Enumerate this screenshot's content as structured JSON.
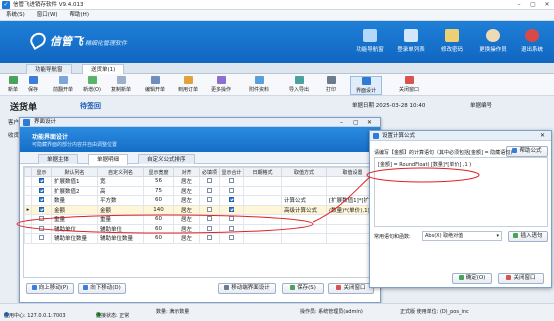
{
  "app": {
    "title": "信管飞进销存软件 V9.4.013"
  },
  "menu": [
    "系统(S)",
    "窗口(W)",
    "帮助(H)"
  ],
  "brand": {
    "name": "信管飞",
    "tagline": "精细化管理软件",
    "color": "#1066c0"
  },
  "banner_buttons": [
    {
      "label": "功能导航窗",
      "icon": "navigation-icon"
    },
    {
      "label": "登录单列表",
      "icon": "list-icon"
    },
    {
      "label": "修改密码",
      "icon": "key-icon"
    },
    {
      "label": "更换操作员",
      "icon": "user-switch-icon"
    },
    {
      "label": "退出系统",
      "icon": "exit-icon"
    }
  ],
  "tabs": [
    "功能导航窗",
    "送货单(1)"
  ],
  "toolbar": [
    "新单",
    "保存",
    "前翻开单",
    "新增(O)",
    "复制新单",
    "编辑开单",
    "到用订单",
    "更多操作",
    "附件资料",
    "导入导出",
    "打印",
    "界面设计",
    "关闭窗口"
  ],
  "document": {
    "title": "送货单",
    "number": "待签回",
    "date_label": "单据日期",
    "date_value": "2025-03-28 10:40",
    "number_label": "单据编号"
  },
  "left_labels": [
    "客户",
    "收货"
  ],
  "designer": {
    "title": "界面设计",
    "banner_title": "功能界面设计",
    "banner_desc": "可隐藏界面的部分内容并自由调整位置",
    "tabs": [
      "单据主体",
      "单据明细",
      "自定义公式排序"
    ],
    "columns": [
      "显示",
      "默认列名",
      "自定义列名",
      "显示宽度",
      "对齐",
      "必填项",
      "显示合计",
      "日期格式",
      "取值方式",
      "取值设置"
    ],
    "rows": [
      {
        "show": true,
        "default": "扩展数值1",
        "custom": "宽",
        "width": "56",
        "align": "居左",
        "required": false,
        "total": false,
        "datefmt": "",
        "mode": "",
        "setting": ""
      },
      {
        "show": true,
        "default": "扩展数值2",
        "custom": "高",
        "width": "75",
        "align": "居左",
        "required": false,
        "total": false,
        "datefmt": "",
        "mode": "",
        "setting": ""
      },
      {
        "show": true,
        "default": "数量",
        "custom": "平方数",
        "width": "60",
        "align": "居左",
        "required": false,
        "total": true,
        "datefmt": "",
        "mode": "计算公式",
        "setting": "[扩展数值1]*[扩展数值2]"
      },
      {
        "show": true,
        "default": "金额",
        "custom": "金额",
        "width": "140",
        "align": "居左",
        "required": false,
        "total": true,
        "datefmt": "",
        "mode": "高级计算公式",
        "setting": "(数量)*(单价),1)"
      },
      {
        "show": false,
        "default": "重量",
        "custom": "重量",
        "width": "60",
        "align": "居左",
        "required": false,
        "total": false,
        "datefmt": "",
        "mode": "",
        "setting": ""
      },
      {
        "show": false,
        "default": "辅助单位",
        "custom": "辅助单位",
        "width": "60",
        "align": "居左",
        "required": false,
        "total": false,
        "datefmt": "",
        "mode": "",
        "setting": ""
      },
      {
        "show": false,
        "default": "辅助单位数量",
        "custom": "辅助单位数量",
        "width": "60",
        "align": "居左",
        "required": false,
        "total": false,
        "datefmt": "",
        "mode": "",
        "setting": ""
      }
    ],
    "buttons": {
      "up": "向上移动(P)",
      "down": "向下移动(D)",
      "restore": "移动端界面设计",
      "save": "保存(S)",
      "close": "关闭窗口"
    }
  },
  "formula": {
    "title": "设置计算公式",
    "help_btn": "帮助公式",
    "desc": "请编写【金额】的计算语句（其中必须包括[金额] = 隐藏语句)",
    "code": "[金额] = RoundFloat( [数量]*[单价] ,1 )",
    "func_label": "常用语句和函数:",
    "func_value": "Abs(X) 取绝对值",
    "insert_btn": "插入语句",
    "ok": "确定(O)",
    "close": "关闭窗口"
  },
  "status": {
    "server": "应用中心: 127.0.0.1:7003",
    "conn": "连接状态: 正常",
    "info": "数量: 满示数量",
    "operator": "操作员: 系统管理员(admin)",
    "version": "正式版 使用单位: (D)_pos_inc"
  }
}
